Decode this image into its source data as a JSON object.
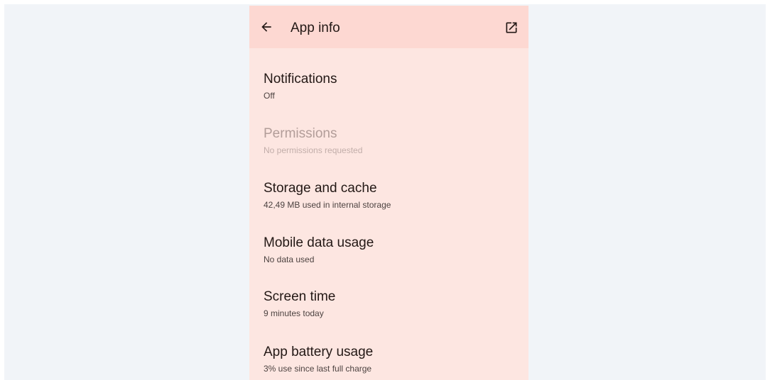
{
  "header": {
    "title": "App info",
    "back_icon": "arrow-back-icon",
    "open_icon": "open-in-new-icon"
  },
  "settings": [
    {
      "title": "Notifications",
      "subtitle": "Off",
      "enabled": true
    },
    {
      "title": "Permissions",
      "subtitle": "No permissions requested",
      "enabled": false
    },
    {
      "title": "Storage and cache",
      "subtitle": "42,49 MB used in internal storage",
      "enabled": true
    },
    {
      "title": "Mobile data usage",
      "subtitle": "No data used",
      "enabled": true
    },
    {
      "title": "Screen time",
      "subtitle": "9 minutes today",
      "enabled": true
    },
    {
      "title": "App battery usage",
      "subtitle": "3% use since last full charge",
      "enabled": true
    }
  ],
  "colors": {
    "background": "#f1f4f8",
    "surface": "#fde6e1",
    "topbar": "#fdd8d2",
    "text_primary": "#231815",
    "text_disabled": "#b29d99"
  }
}
